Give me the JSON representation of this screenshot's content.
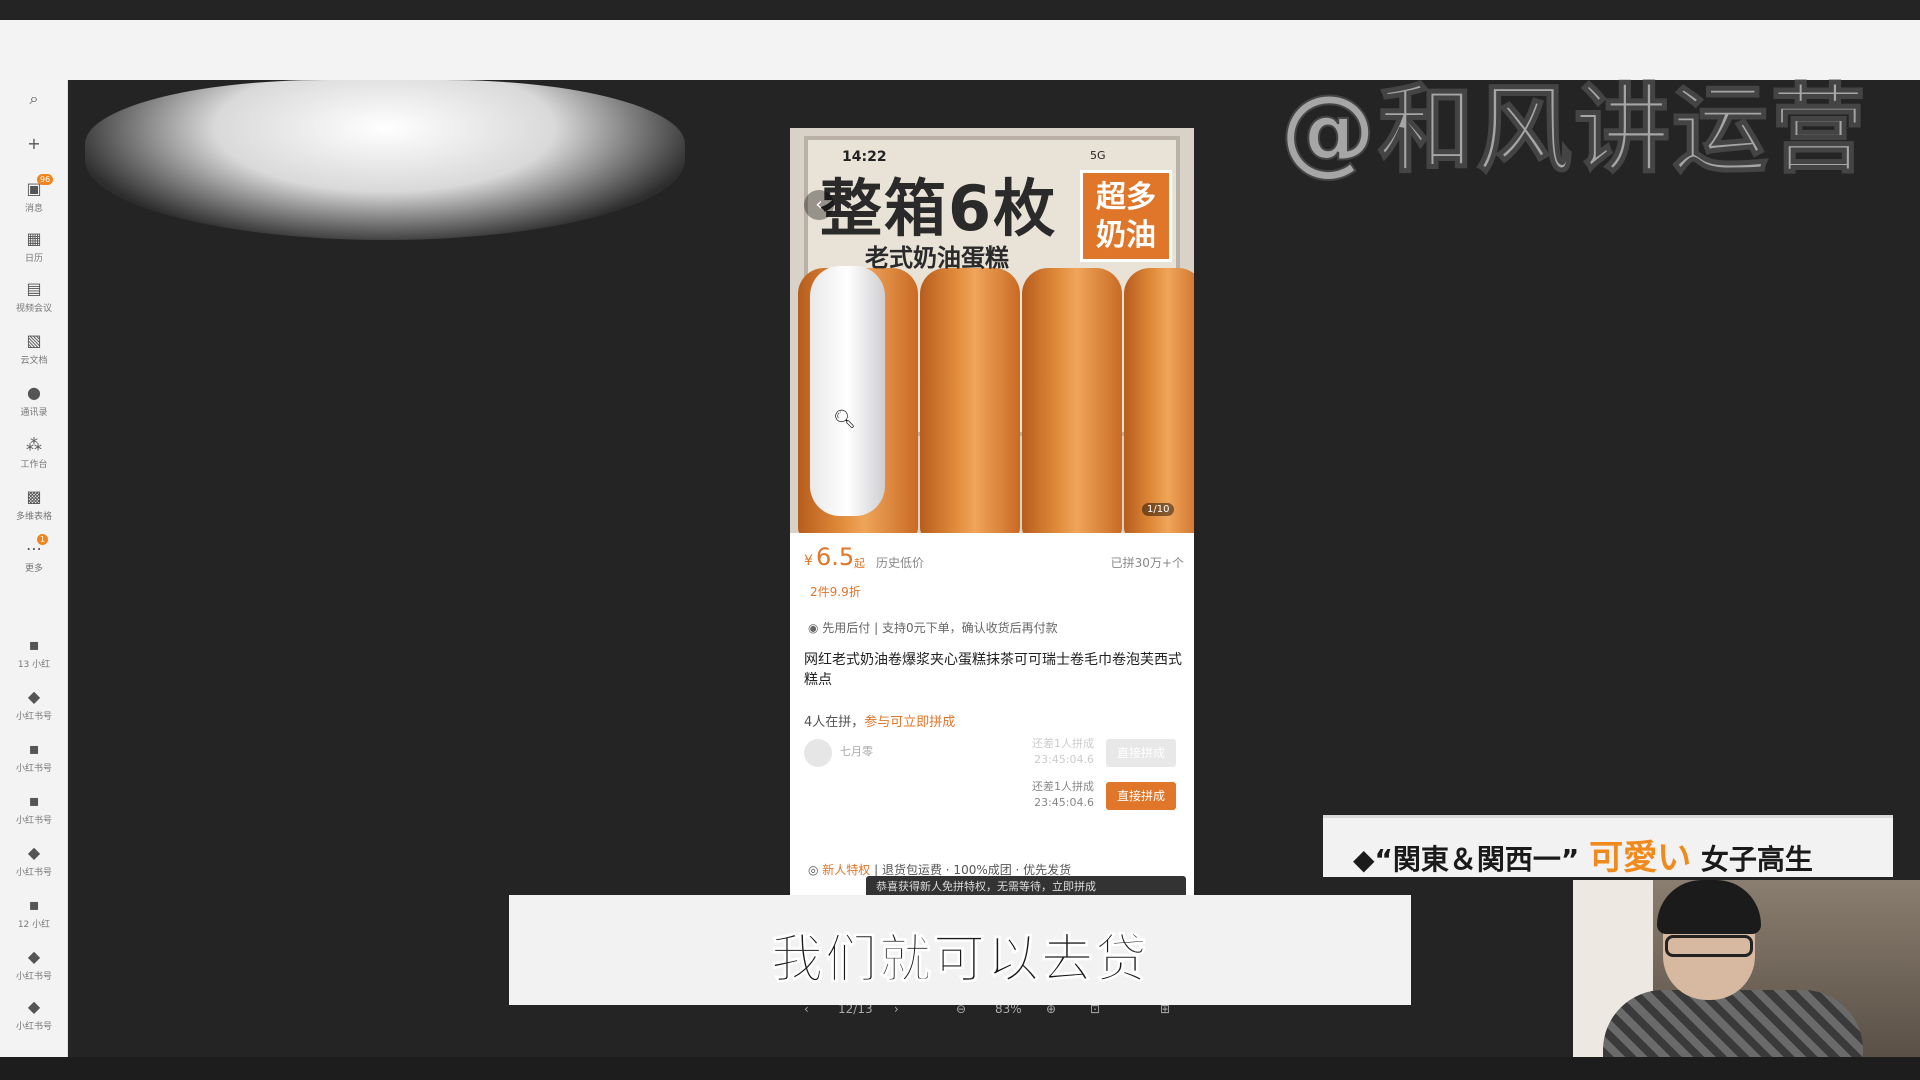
{
  "watermark": "@和风讲运营",
  "sidebar": {
    "items": [
      {
        "icon": "search-icon",
        "label": ""
      },
      {
        "icon": "plus-icon",
        "label": ""
      },
      {
        "icon": "message-icon",
        "label": "消息",
        "badge": "96"
      },
      {
        "icon": "calendar-icon",
        "label": "日历"
      },
      {
        "icon": "video-icon",
        "label": "视频会议"
      },
      {
        "icon": "document-icon",
        "label": "云文档"
      },
      {
        "icon": "contacts-icon",
        "label": "通讯录"
      },
      {
        "icon": "workspace-icon",
        "label": "工作台"
      },
      {
        "icon": "apps-icon",
        "label": "多维表格"
      },
      {
        "icon": "more-icon",
        "label": "更多",
        "badge": "1"
      }
    ],
    "accounts": [
      {
        "label": "13 小红"
      },
      {
        "label": "小红书号"
      },
      {
        "label": "小红书号"
      },
      {
        "label": "小红书号"
      },
      {
        "label": "小红书号"
      },
      {
        "label": "12 小红"
      },
      {
        "label": "小红书号"
      },
      {
        "label": "小红书号"
      }
    ]
  },
  "product": {
    "status_time": "14:22",
    "status_icons": "5G",
    "hero_title": "整箱6枚",
    "hero_subtitle": "老式奶油蛋糕",
    "hero_badge_line1": "超多",
    "hero_badge_line2": "奶油",
    "image_counter": "1/10",
    "price_symbol": "¥",
    "price": "6.5",
    "price_suffix": "起",
    "price_note": "历史低价",
    "sold": "已拼30万+个",
    "discount": "2件9.9折",
    "pay_later": "先用后付 | 支持0元下单，确认收货后再付款",
    "title": "网红老式奶油卷爆浆夹心蛋糕抹茶可可瑞士卷毛巾卷泡芙西式糕点",
    "group_count": "4人在拼，",
    "group_link": "参与可立即拼成",
    "groups": [
      {
        "name": "七月零",
        "need": "还差1人拼成",
        "timer": "23:45:04.6",
        "button": "直接拼成",
        "faded": true
      },
      {
        "name": "",
        "need": "还差1人拼成",
        "timer": "23:45:04.6",
        "button": "直接拼成",
        "faded": false
      }
    ],
    "perk_name": "新人特权",
    "perk_text": "退货包运费 · 100%成团 · 优先发货",
    "toast": "恭喜获得新人免拼特权，无需等待，立即拼成"
  },
  "viewer_toolbar": {
    "prev": "‹",
    "page": "12/13",
    "next": "›",
    "zoom_out": "⊖",
    "zoom": "83%",
    "zoom_in": "⊕",
    "fit": "⊡",
    "fullscreen": "⊞"
  },
  "caption": "我们就可以去贷",
  "banner": {
    "prefix": "◆“関東＆関西一”",
    "highlight": "可愛い",
    "suffix": "女子高生"
  }
}
